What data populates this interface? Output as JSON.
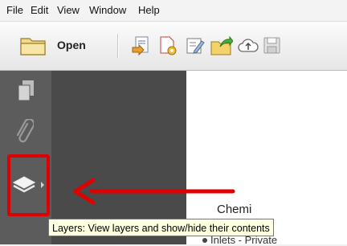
{
  "menu": {
    "file": "File",
    "edit": "Edit",
    "view": "View",
    "window": "Window",
    "help": "Help"
  },
  "toolbar": {
    "open_label": "Open",
    "icons": [
      "folder-open-icon",
      "create-pdf-icon",
      "settings-document-icon",
      "edit-document-icon",
      "share-folder-icon",
      "cloud-upload-icon",
      "save-icon"
    ]
  },
  "sidebar": {
    "icons": [
      "pages-icon",
      "attachments-icon",
      "layers-icon"
    ],
    "accent": "#e00000"
  },
  "document": {
    "text1": "Chemi",
    "text2": "Inlets - Private"
  },
  "tooltip": {
    "text": "Layers: View layers and show/hide their contents"
  }
}
